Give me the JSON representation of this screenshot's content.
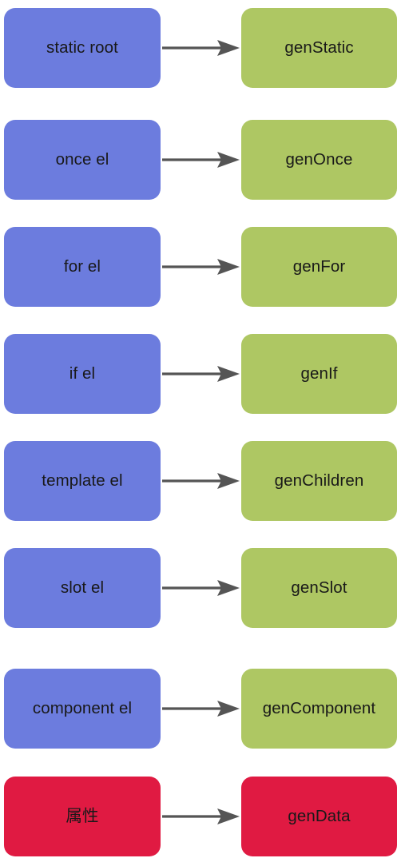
{
  "diagram": {
    "type": "flowchart",
    "orientation": "left-to-right-pairs",
    "background_color": "#ffffff",
    "arrow_color": "#555555",
    "text_color": "#191919",
    "palette": {
      "blue": "#6C7CDE",
      "green": "#AEC763",
      "red": "#E01A42"
    },
    "rows": [
      {
        "source": {
          "label": "static root",
          "color": "#6C7CDE"
        },
        "target": {
          "label": "genStatic",
          "color": "#AEC763"
        },
        "arrow": "arrow-right"
      },
      {
        "source": {
          "label": "once el",
          "color": "#6C7CDE"
        },
        "target": {
          "label": "genOnce",
          "color": "#AEC763"
        },
        "arrow": "arrow-right"
      },
      {
        "source": {
          "label": "for el",
          "color": "#6C7CDE"
        },
        "target": {
          "label": "genFor",
          "color": "#AEC763"
        },
        "arrow": "arrow-right"
      },
      {
        "source": {
          "label": "if el",
          "color": "#6C7CDE"
        },
        "target": {
          "label": "genIf",
          "color": "#AEC763"
        },
        "arrow": "arrow-right"
      },
      {
        "source": {
          "label": "template el",
          "color": "#6C7CDE"
        },
        "target": {
          "label": "genChildren",
          "color": "#AEC763"
        },
        "arrow": "arrow-right"
      },
      {
        "source": {
          "label": "slot el",
          "color": "#6C7CDE"
        },
        "target": {
          "label": "genSlot",
          "color": "#AEC763"
        },
        "arrow": "arrow-right"
      },
      {
        "source": {
          "label": "component el",
          "color": "#6C7CDE"
        },
        "target": {
          "label": "genComponent",
          "color": "#AEC763"
        },
        "arrow": "arrow-right"
      },
      {
        "source": {
          "label": "属性",
          "color": "#E01A42"
        },
        "target": {
          "label": "genData",
          "color": "#E01A42"
        },
        "arrow": "arrow-right"
      }
    ]
  }
}
